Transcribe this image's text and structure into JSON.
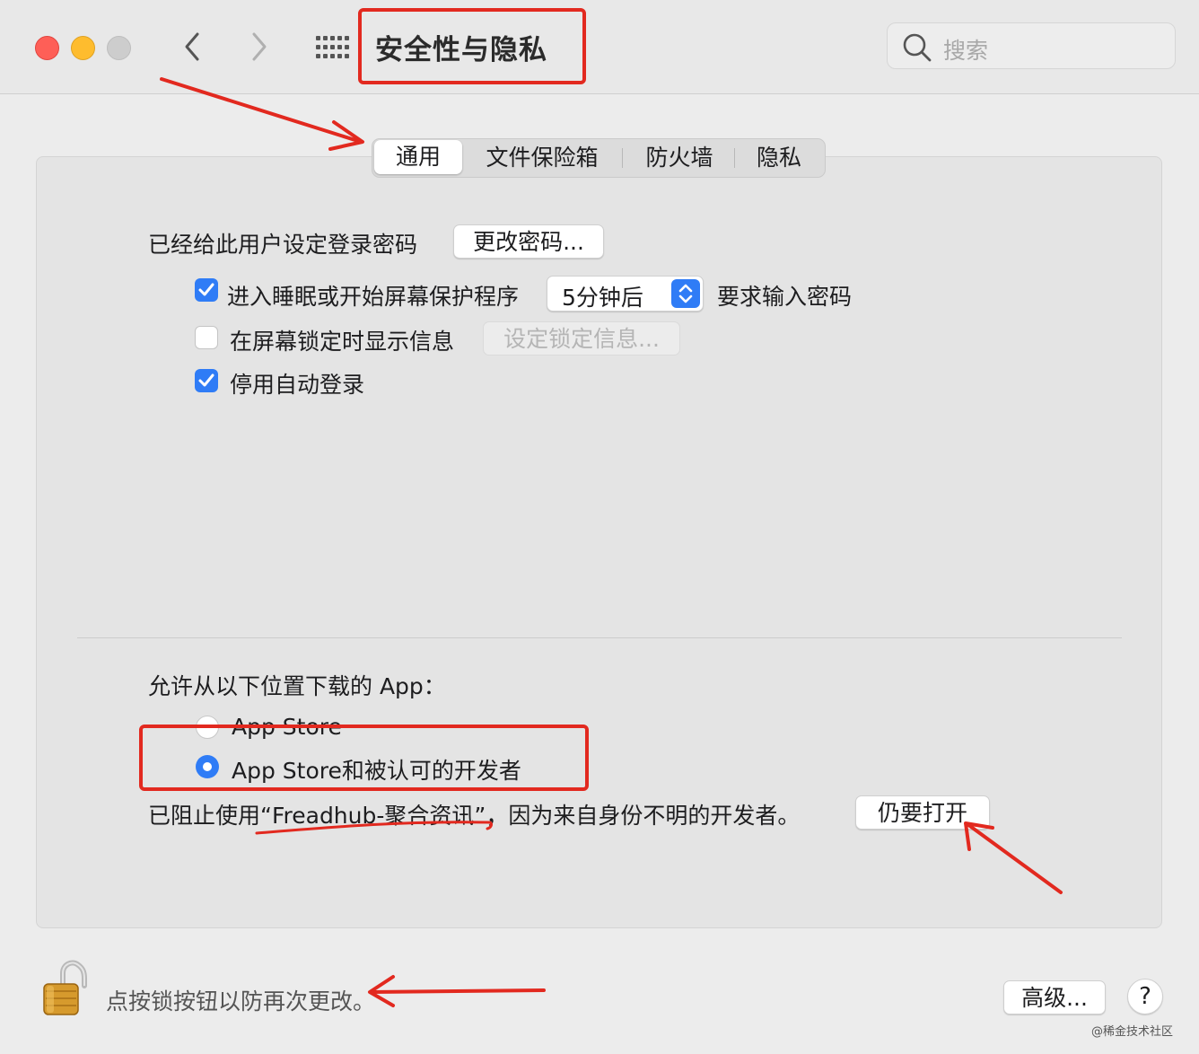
{
  "window": {
    "title": "安全性与隐私"
  },
  "search": {
    "placeholder": "搜索"
  },
  "tabs": [
    {
      "label": "通用",
      "active": true
    },
    {
      "label": "文件保险箱",
      "active": false
    },
    {
      "label": "防火墙",
      "active": false
    },
    {
      "label": "隐私",
      "active": false
    }
  ],
  "general": {
    "password_set_label": "已经给此用户设定登录密码",
    "change_password_button": "更改密码...",
    "require_password": {
      "label": "进入睡眠或开始屏幕保护程序",
      "checked": true,
      "delay": "5分钟后",
      "suffix": "要求输入密码"
    },
    "show_message": {
      "label": "在屏幕锁定时显示信息",
      "checked": false,
      "button": "设定锁定信息..."
    },
    "disable_autologin": {
      "label": "停用自动登录",
      "checked": true
    }
  },
  "downloads": {
    "heading": "允许从以下位置下载的 App：",
    "options": [
      {
        "label": "App Store",
        "selected": false
      },
      {
        "label": "App Store和被认可的开发者",
        "selected": true
      }
    ],
    "blocked_message": "已阻止使用“Freadhub-聚合资讯”，因为来自身份不明的开发者。",
    "open_anyway_button": "仍要打开"
  },
  "footer": {
    "lock_text": "点按锁按钮以防再次更改。",
    "advanced_button": "高级...",
    "help_button": "?"
  },
  "watermark": "@稀金技术社区",
  "colors": {
    "accent": "#2f7cf6",
    "annotation": "#e2291f"
  }
}
